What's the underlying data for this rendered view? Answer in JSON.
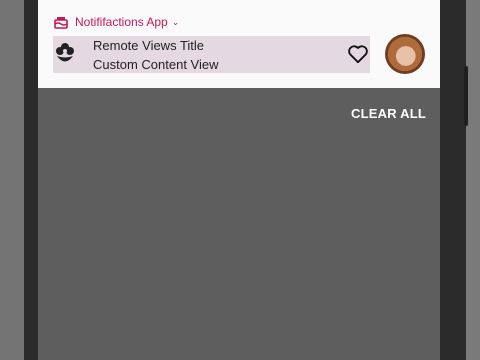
{
  "notification": {
    "app_name": "Notififactions App",
    "app_icon": "cake-icon",
    "expand_icon": "chevron-down-icon",
    "custom_view": {
      "title": "Remote Views Title",
      "subtitle": "Custom Content View",
      "icon": "flower-icon",
      "action_icon": "heart-outline-icon"
    },
    "avatar": "user-avatar"
  },
  "shade": {
    "clear_all_label": "CLEAR ALL"
  },
  "colors": {
    "accent": "#c2185b",
    "custom_view_bg": "#e4d9e1",
    "shade_bg": "#5f5e5f"
  }
}
